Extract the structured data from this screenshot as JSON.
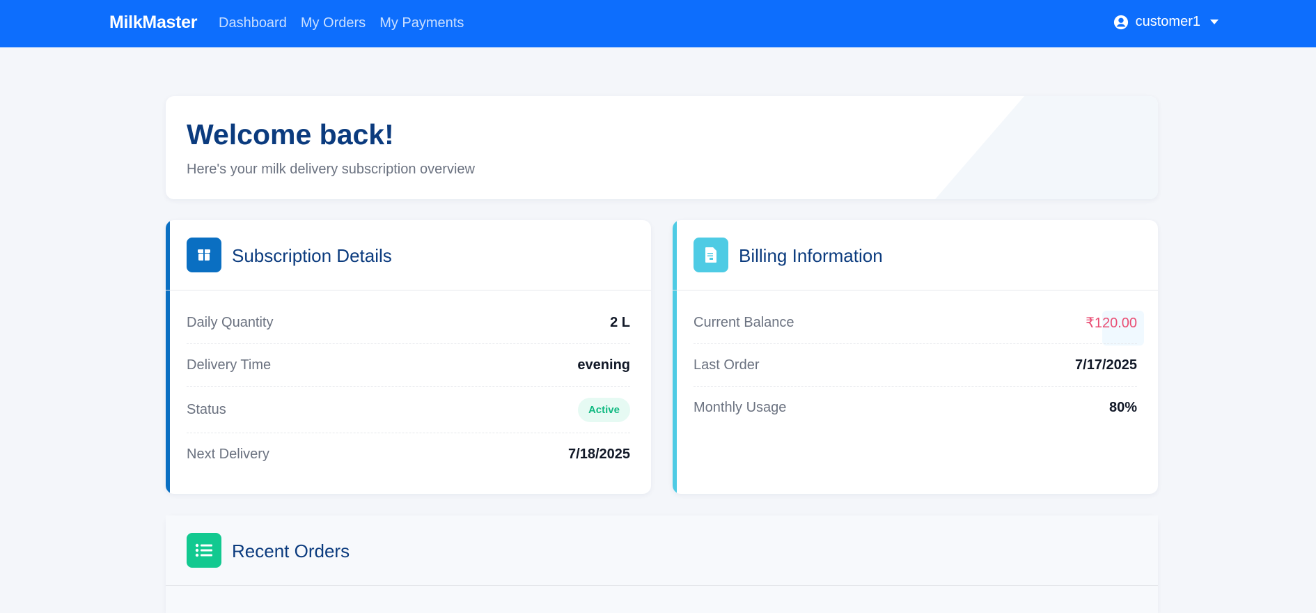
{
  "nav": {
    "brand": "MilkMaster",
    "links": [
      "Dashboard",
      "My Orders",
      "My Payments"
    ],
    "user": "customer1"
  },
  "welcome": {
    "title": "Welcome back!",
    "subtitle": "Here's your milk delivery subscription overview"
  },
  "subscription": {
    "title": "Subscription Details",
    "icon": "box-icon",
    "accent": "#0a6fc2",
    "rows": [
      {
        "label": "Daily Quantity",
        "value": "2 L"
      },
      {
        "label": "Delivery Time",
        "value": "evening"
      },
      {
        "label": "Status",
        "value": "Active"
      },
      {
        "label": "Next Delivery",
        "value": "7/18/2025"
      }
    ]
  },
  "billing": {
    "title": "Billing Information",
    "icon": "invoice-icon",
    "accent": "#4ecbe4",
    "rows": [
      {
        "label": "Current Balance",
        "value": "₹120.00"
      },
      {
        "label": "Last Order",
        "value": "7/17/2025"
      },
      {
        "label": "Monthly Usage",
        "value": "80%"
      }
    ]
  },
  "orders": {
    "title": "Recent Orders",
    "icon": "list-icon",
    "accent": "#12c990"
  },
  "colors": {
    "primary": "#0d6efd",
    "heading": "#0b3b7e",
    "success": "#10b981",
    "balance": "#e94d73"
  }
}
